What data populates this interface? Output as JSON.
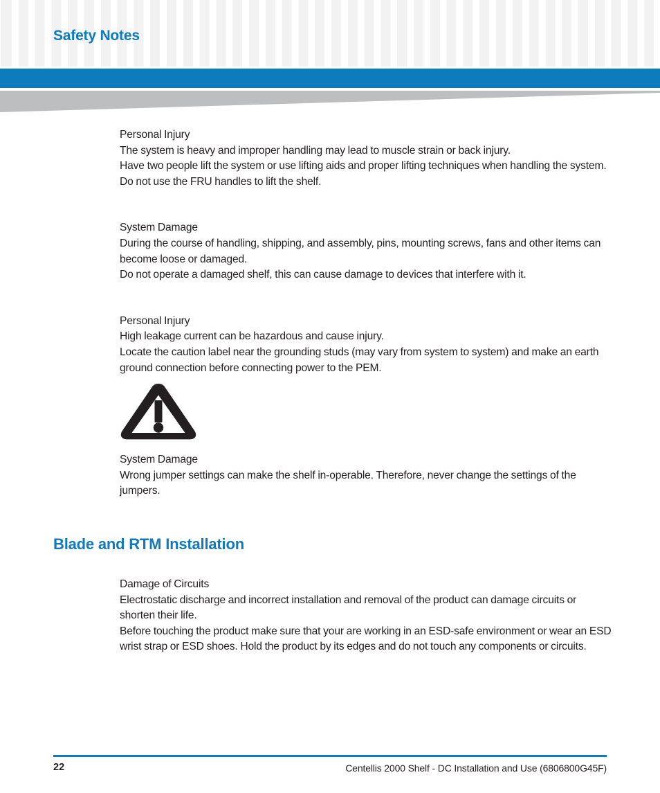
{
  "header": {
    "title": "Safety Notes",
    "accent_color": "#0f7ab9",
    "band_color": "#0c7cbc",
    "wedge_color": "#bcbec0",
    "grid_square_color": "#f2f2f2"
  },
  "blocks": [
    {
      "kind": "note",
      "lines": [
        "Personal Injury",
        "The system is heavy and improper handling may lead to muscle strain or back injury.",
        "Have two people lift the system or use lifting aids and proper lifting techniques when handling the system. Do not use the FRU handles to lift the shelf."
      ]
    },
    {
      "kind": "note",
      "lines": [
        "System Damage",
        "During the course of handling, shipping, and assembly, pins, mounting screws, fans and other items can become loose or damaged.",
        "Do not operate a damaged shelf, this can cause damage to devices that interfere with it."
      ]
    },
    {
      "kind": "note",
      "lines": [
        "Personal Injury",
        "High leakage current can be hazardous and cause injury.",
        "Locate the caution label near the grounding studs (may vary from system to system) and make an earth ground connection before connecting power to the PEM."
      ]
    },
    {
      "kind": "icon",
      "icon": "warning-triangle-icon",
      "icon_color": "#231f20"
    },
    {
      "kind": "note",
      "lines": [
        "System Damage",
        "Wrong jumper settings can make the shelf in-operable. Therefore, never change the settings of the jumpers."
      ]
    },
    {
      "kind": "heading",
      "text": "Blade and RTM Installation",
      "color": "#1179bd"
    },
    {
      "kind": "note",
      "lines": [
        "Damage of Circuits",
        "Electrostatic discharge and incorrect installation and removal of the product can damage circuits or shorten their life.",
        "Before touching the product make sure that your are working in an ESD-safe environment or wear an ESD wrist strap or ESD shoes. Hold the product by its edges and do not touch any components or circuits."
      ]
    }
  ],
  "footer": {
    "page_number": "22",
    "document_title": "Centellis 2000 Shelf - DC Installation and Use (6806800G45F)",
    "rule_color": "#0c7cbc"
  }
}
